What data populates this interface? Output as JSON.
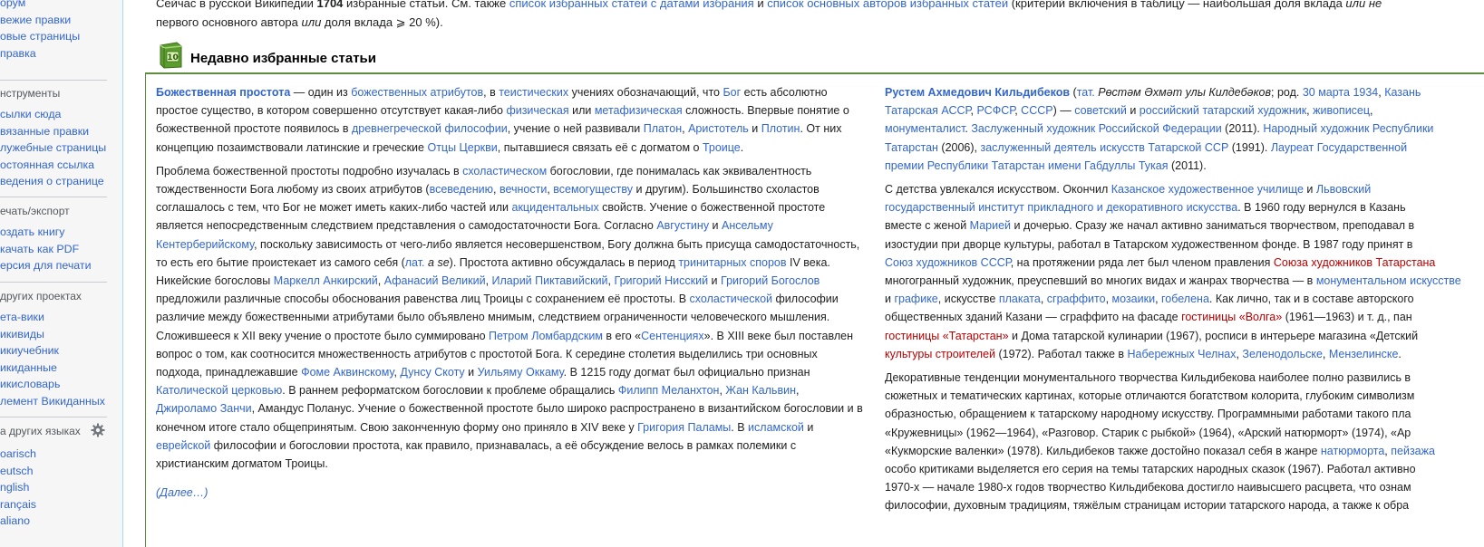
{
  "sidebar": {
    "nav_items": [
      "орум",
      "вежие правки",
      "овые страницы",
      "правка"
    ],
    "tools_heading": "нструменты",
    "tools_items": [
      "сылки сюда",
      "вязанные правки",
      "лужебные страницы",
      "остоянная ссылка",
      "ведения о странице"
    ],
    "print_heading": "ечать/экспорт",
    "print_items": [
      "оздать книгу",
      "качать как PDF",
      "ерсия для печати"
    ],
    "projects_heading": " других проектах",
    "projects_items": [
      "ета-вики",
      "икивиды",
      "икиучебник",
      "икиданные",
      "икисловарь",
      "лемент Викиданных"
    ],
    "languages_heading": "а других языках",
    "languages_items": [
      "oarisch",
      "eutsch",
      "nglish",
      "rançais",
      "aliano"
    ]
  },
  "topline": {
    "line1_pre": "Сейчас в русской Википедии ",
    "line1_count": "1704",
    "line1_mid": " избранные статьи. См. также ",
    "line1_link1": "список избранных статей с датами избрания",
    "line1_and": " и ",
    "line1_link2": "список основных авторов избранных статей",
    "line1_post": " (критерий включения в таблицу — наибольшая доля вклада ",
    "line1_italic": "или не",
    "line2_pre": "первого основного автора ",
    "line2_italic": "или",
    "line2_post": " доля вклада ⩾ 20 %)."
  },
  "panel": {
    "title": "Недавно избранные статьи",
    "icon": "featured-book-icon"
  },
  "article1": {
    "more_link": "(Далее…)"
  },
  "colors": {
    "link": "#3366cc",
    "redlink": "#ba0000",
    "panel_border": "#5f8d3f"
  }
}
